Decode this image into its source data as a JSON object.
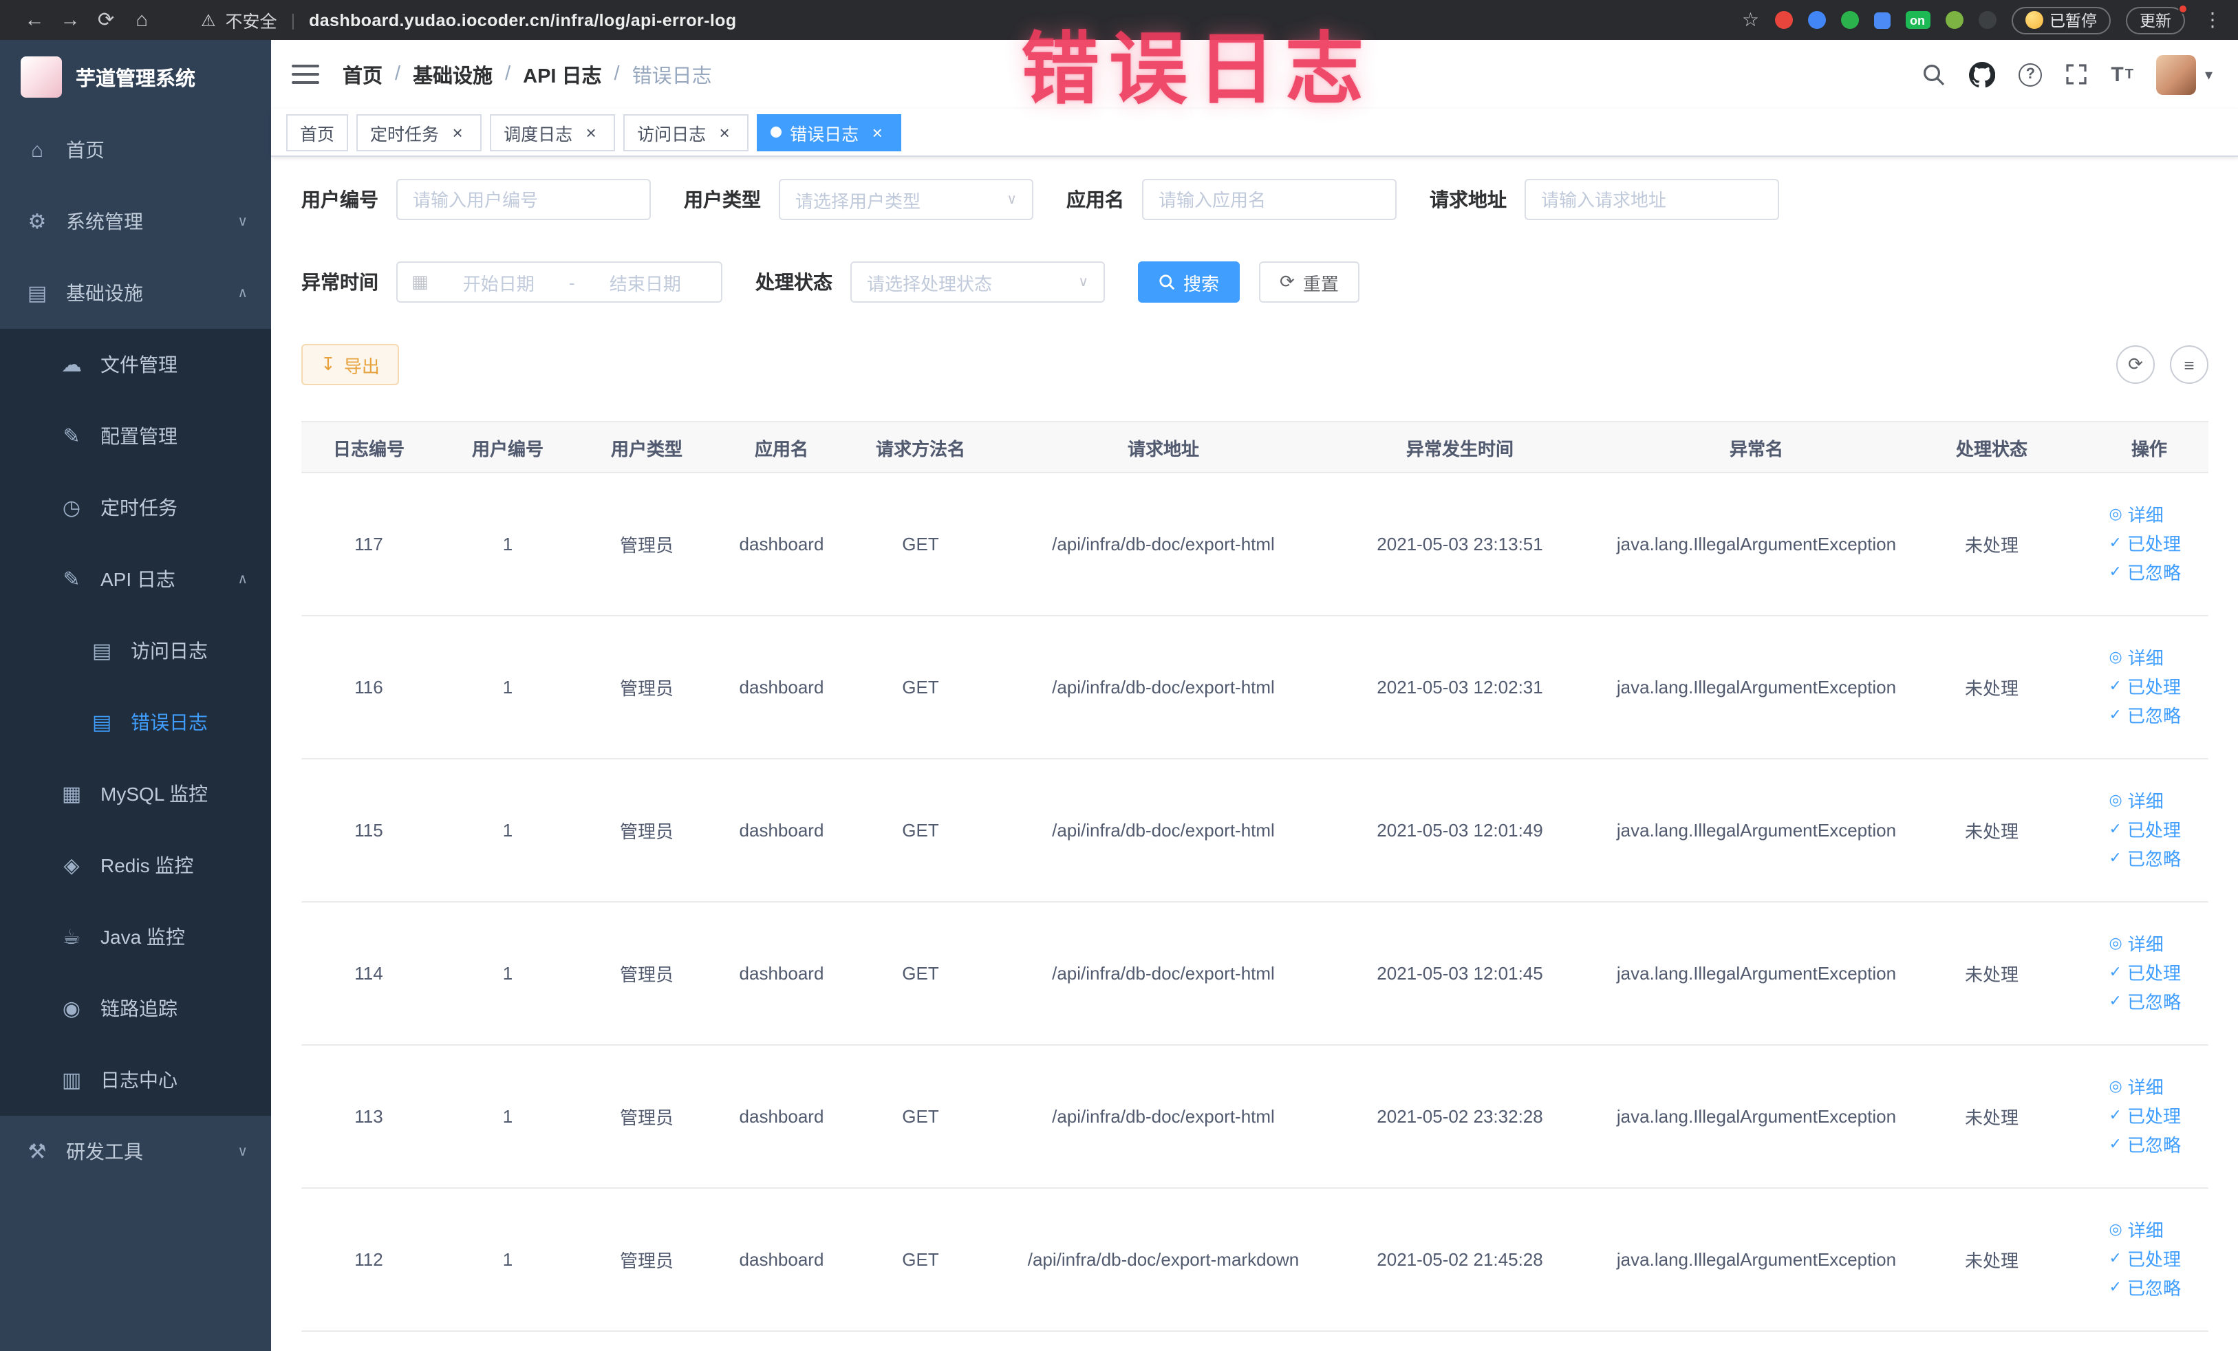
{
  "browser": {
    "security_label": "不安全",
    "url": "dashboard.yudao.iocoder.cn/infra/log/api-error-log",
    "paused_label": "已暂停",
    "update_label": "更新",
    "extension_on_label": "on"
  },
  "annotation": {
    "text": "错误日志"
  },
  "sidebar": {
    "logo_title": "芋道管理系统",
    "items": [
      {
        "id": "home",
        "label": "首页",
        "icon": "home-icon",
        "level": 1
      },
      {
        "id": "system",
        "label": "系统管理",
        "icon": "gear-icon",
        "level": 1,
        "chevron": "down"
      },
      {
        "id": "infra",
        "label": "基础设施",
        "icon": "infra-icon",
        "level": 1,
        "chevron": "up"
      },
      {
        "id": "file",
        "label": "文件管理",
        "icon": "cloud-icon",
        "level": 2
      },
      {
        "id": "config",
        "label": "配置管理",
        "icon": "edit-icon",
        "level": 2
      },
      {
        "id": "job",
        "label": "定时任务",
        "icon": "timer-icon",
        "level": 2
      },
      {
        "id": "api-log",
        "label": "API 日志",
        "icon": "log-icon",
        "level": 2,
        "chevron": "up"
      },
      {
        "id": "access-log",
        "label": "访问日志",
        "icon": "doc-icon",
        "level": 3
      },
      {
        "id": "error-log",
        "label": "错误日志",
        "icon": "doc-icon",
        "level": 3,
        "active": true
      },
      {
        "id": "mysql",
        "label": "MySQL 监控",
        "icon": "database-icon",
        "level": 2
      },
      {
        "id": "redis",
        "label": "Redis 监控",
        "icon": "redis-icon",
        "level": 2
      },
      {
        "id": "java",
        "label": "Java 监控",
        "icon": "coffee-icon",
        "level": 2
      },
      {
        "id": "trace",
        "label": "链路追踪",
        "icon": "trace-icon",
        "level": 2
      },
      {
        "id": "log-center",
        "label": "日志中心",
        "icon": "log-center-icon",
        "level": 2
      },
      {
        "id": "dev-tools",
        "label": "研发工具",
        "icon": "tools-icon",
        "level": 1,
        "chevron": "down"
      }
    ]
  },
  "header": {
    "breadcrumb": [
      "首页",
      "基础设施",
      "API 日志",
      "错误日志"
    ]
  },
  "tabs": [
    {
      "id": "home",
      "label": "首页",
      "closable": false,
      "active": false
    },
    {
      "id": "scheduled-job",
      "label": "定时任务",
      "closable": true,
      "active": false
    },
    {
      "id": "job-log",
      "label": "调度日志",
      "closable": true,
      "active": false
    },
    {
      "id": "access-log",
      "label": "访问日志",
      "closable": true,
      "active": false
    },
    {
      "id": "error-log",
      "label": "错误日志",
      "closable": true,
      "active": true
    }
  ],
  "filters": {
    "user_id": {
      "label": "用户编号",
      "placeholder": "请输入用户编号"
    },
    "user_type": {
      "label": "用户类型",
      "placeholder": "请选择用户类型"
    },
    "app_name": {
      "label": "应用名",
      "placeholder": "请输入应用名"
    },
    "request_url": {
      "label": "请求地址",
      "placeholder": "请输入请求地址"
    },
    "exception_time": {
      "label": "异常时间",
      "start_placeholder": "开始日期",
      "separator": "-",
      "end_placeholder": "结束日期"
    },
    "process_status": {
      "label": "处理状态",
      "placeholder": "请选择处理状态"
    },
    "search_button": "搜索",
    "reset_button": "重置"
  },
  "toolbar": {
    "export_button": "导出"
  },
  "table": {
    "columns": [
      "日志编号",
      "用户编号",
      "用户类型",
      "应用名",
      "请求方法名",
      "请求地址",
      "异常发生时间",
      "异常名",
      "处理状态",
      "操作"
    ],
    "rows": [
      {
        "id": "117",
        "user_id": "1",
        "user_type": "管理员",
        "app_name": "dashboard",
        "method": "GET",
        "url": "/api/infra/db-doc/export-html",
        "time": "2021-05-03 23:13:51",
        "exception": "java.lang.IllegalArgumentException",
        "status": "未处理"
      },
      {
        "id": "116",
        "user_id": "1",
        "user_type": "管理员",
        "app_name": "dashboard",
        "method": "GET",
        "url": "/api/infra/db-doc/export-html",
        "time": "2021-05-03 12:02:31",
        "exception": "java.lang.IllegalArgumentException",
        "status": "未处理"
      },
      {
        "id": "115",
        "user_id": "1",
        "user_type": "管理员",
        "app_name": "dashboard",
        "method": "GET",
        "url": "/api/infra/db-doc/export-html",
        "time": "2021-05-03 12:01:49",
        "exception": "java.lang.IllegalArgumentException",
        "status": "未处理"
      },
      {
        "id": "114",
        "user_id": "1",
        "user_type": "管理员",
        "app_name": "dashboard",
        "method": "GET",
        "url": "/api/infra/db-doc/export-html",
        "time": "2021-05-03 12:01:45",
        "exception": "java.lang.IllegalArgumentException",
        "status": "未处理"
      },
      {
        "id": "113",
        "user_id": "1",
        "user_type": "管理员",
        "app_name": "dashboard",
        "method": "GET",
        "url": "/api/infra/db-doc/export-html",
        "time": "2021-05-02 23:32:28",
        "exception": "java.lang.IllegalArgumentException",
        "status": "未处理"
      },
      {
        "id": "112",
        "user_id": "1",
        "user_type": "管理员",
        "app_name": "dashboard",
        "method": "GET",
        "url": "/api/infra/db-doc/export-markdown",
        "time": "2021-05-02 21:45:28",
        "exception": "java.lang.IllegalArgumentException",
        "status": "未处理"
      }
    ],
    "row_actions": [
      "详细",
      "已处理",
      "已忽略"
    ]
  },
  "colors": {
    "accent": "#409eff",
    "sidebar_bg": "#304156",
    "submenu_bg": "#1f2d3d",
    "warning": "#e6a23c",
    "annotation": "#ef3d60"
  }
}
